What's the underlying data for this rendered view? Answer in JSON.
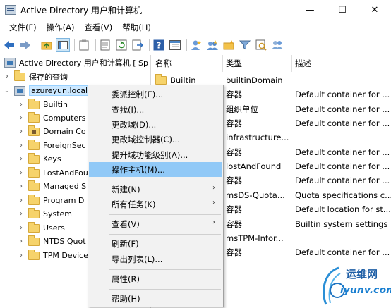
{
  "window": {
    "title": "Active Directory 用户和计算机",
    "minimize": "—",
    "maximize": "☐",
    "close": "✕"
  },
  "menubar": [
    "文件(F)",
    "操作(A)",
    "查看(V)",
    "帮助(H)"
  ],
  "toolbar_icons": [
    "back-icon",
    "forward-icon",
    "up-folder-icon",
    "show-tree-icon",
    "clipboard-icon",
    "properties-icon",
    "refresh-icon",
    "export-icon",
    "help-icon",
    "console-icon",
    "add-user-icon",
    "add-group-icon",
    "add-ou-icon",
    "filter-icon",
    "find-icon",
    "add-to-group-icon"
  ],
  "tree": {
    "root": "Active Directory 用户和计算机 [ Sp",
    "saved_queries": "保存的查询",
    "domain": "azureyun.local",
    "children": [
      "Builtin",
      "Computers",
      "Domain Co",
      "ForeignSec",
      "Keys",
      "LostAndFou",
      "Managed S",
      "Program D",
      "System",
      "Users",
      "NTDS Quot",
      "TPM Device"
    ]
  },
  "list": {
    "columns": [
      "名称",
      "类型",
      "描述"
    ],
    "rows": [
      {
        "name": "Builtin",
        "type": "builtinDomain",
        "desc": ""
      },
      {
        "name": "",
        "type": "容器",
        "desc": "Default container for ..."
      },
      {
        "name": "",
        "type": "组织单位",
        "desc": "Default container for ..."
      },
      {
        "name": "",
        "type": "容器",
        "desc": "Default container for ..."
      },
      {
        "name": "",
        "type": "infrastructure...",
        "desc": ""
      },
      {
        "name": "",
        "type": "容器",
        "desc": "Default container for ..."
      },
      {
        "name": "",
        "type": "lostAndFound",
        "desc": "Default container for ..."
      },
      {
        "name": "",
        "type": "容器",
        "desc": "Default container for ..."
      },
      {
        "name": "",
        "type": "msDS-Quota...",
        "desc": "Quota specifications c..."
      },
      {
        "name": "",
        "type": "容器",
        "desc": "Default location for st..."
      },
      {
        "name": "",
        "type": "容器",
        "desc": "Builtin system settings"
      },
      {
        "name": "",
        "type": "msTPM-Infor...",
        "desc": ""
      },
      {
        "name": "",
        "type": "容器",
        "desc": "Default container for ..."
      }
    ]
  },
  "context_menu": {
    "items": [
      "委派控制(E)...",
      "查找(I)...",
      "更改域(D)...",
      "更改域控制器(C)...",
      "提升域功能级别(A)...",
      "操作主机(M)...",
      "新建(N)",
      "所有任务(K)",
      "查看(V)",
      "刷新(F)",
      "导出列表(L)...",
      "属性(R)",
      "帮助(H)"
    ],
    "submenu_arrow": "›"
  },
  "watermark": {
    "brand": "运维网",
    "domain": "iyunv.com"
  }
}
